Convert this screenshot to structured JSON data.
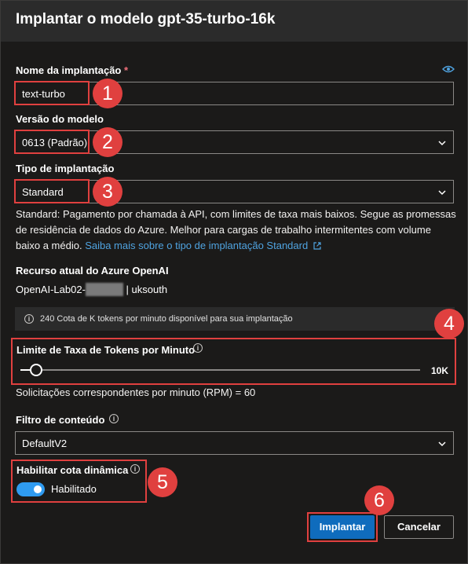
{
  "header": {
    "title": "Implantar o modelo gpt-35-turbo-16k"
  },
  "deployment_name": {
    "label": "Nome da implantação",
    "required_mark": "*",
    "value": "text-turbo",
    "badge": "1"
  },
  "model_version": {
    "label": "Versão do modelo",
    "value": "0613 (Padrão)",
    "badge": "2"
  },
  "deployment_type": {
    "label": "Tipo de implantação",
    "value": "Standard",
    "badge": "3",
    "description_line1": "Standard: Pagamento por chamada à API, com limites de taxa mais baixos. Segue as promessas",
    "description_line2": "de residência de dados do Azure. Melhor para cargas de trabalho intermitentes com volume",
    "description_line3": "baixo a médio.",
    "link_text": "Saiba mais sobre o tipo de implantação Standard"
  },
  "current_resource": {
    "label": "Recurso atual do Azure OpenAI",
    "value_prefix": "OpenAI-Lab02-",
    "value_suffix": "| uksouth"
  },
  "quota_info": {
    "text": "240 Cota de K tokens por minuto disponível para sua implantação"
  },
  "rate_limit": {
    "label": "Limite de Taxa de Tokens por Minuto",
    "value": "10K",
    "fraction": 0.04,
    "badge": "4"
  },
  "rpm": {
    "text": "Solicitações correspondentes por minuto (RPM) = 60"
  },
  "content_filter": {
    "label": "Filtro de conteúdo",
    "value": "DefaultV2"
  },
  "dynamic_quota": {
    "label": "Habilitar cota dinâmica",
    "toggle_label": "Habilitado",
    "badge": "5"
  },
  "actions": {
    "deploy_label": "Implantar",
    "cancel_label": "Cancelar",
    "badge": "6"
  },
  "colors": {
    "accent": "#0f6cbd",
    "highlight": "#e0403f",
    "toggle": "#2f9bf0",
    "link": "#4fa3e0"
  },
  "icons": {
    "visibility": "eye-icon",
    "info": "info-icon",
    "chevron": "chevron-down-icon",
    "external": "external-link-icon"
  }
}
